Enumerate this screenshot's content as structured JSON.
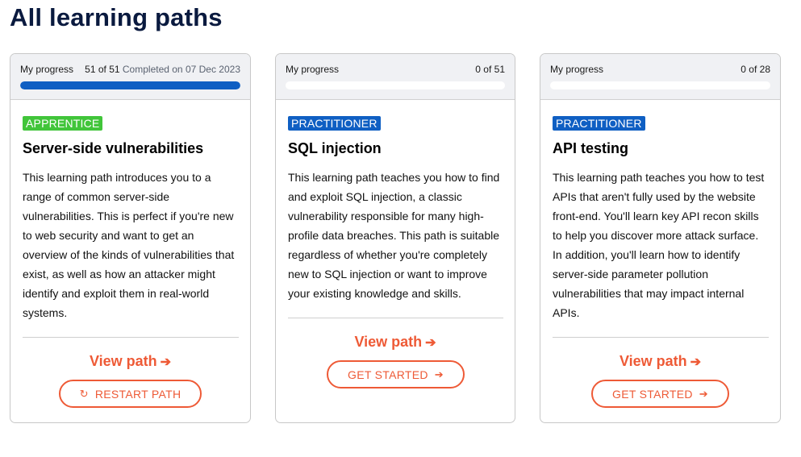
{
  "page": {
    "title": "All learning paths"
  },
  "cards": [
    {
      "progress_label": "My progress",
      "progress_count": "51 of 51",
      "completed_text": "Completed on 07 Dec 2023",
      "progress_fraction": 1.0,
      "badge": "APPRENTICE",
      "title": "Server-side vulnerabilities",
      "description": "This learning path introduces you to a range of common server-side vulnerabilities. This is perfect if you're new to web security and want to get an overview of the kinds of vulnerabilities that exist, as well as how an attacker might identify and exploit them in real-world systems.",
      "view_link": "View path",
      "button_label": "RESTART PATH",
      "button_icon": "restart-icon"
    },
    {
      "progress_label": "My progress",
      "progress_count": "0 of 51",
      "progress_fraction": 0.0,
      "badge": "PRACTITIONER",
      "title": "SQL injection",
      "description": "This learning path teaches you how to find and exploit SQL injection, a classic vulnerability responsible for many high-profile data breaches. This path is suitable regardless of whether you're completely new to SQL injection or want to improve your existing knowledge and skills.",
      "view_link": "View path",
      "button_label": "GET STARTED",
      "button_icon": "arrow-right-icon"
    },
    {
      "progress_label": "My progress",
      "progress_count": "0 of 28",
      "progress_fraction": 0.0,
      "badge": "PRACTITIONER",
      "title": "API testing",
      "description": "This learning path teaches you how to test APIs that aren't fully used by the website front-end. You'll learn key API recon skills to help you discover more attack surface. In addition, you'll learn how to identify server-side parameter pollution vulnerabilities that may impact internal APIs.",
      "view_link": "View path",
      "button_label": "GET STARTED",
      "button_icon": "arrow-right-icon"
    }
  ],
  "colors": {
    "title": "#0a1a3f",
    "progress_fill": "#0f5fc3",
    "apprentice": "#41c53a",
    "practitioner": "#0f5fc3",
    "accent": "#ee5a36"
  }
}
